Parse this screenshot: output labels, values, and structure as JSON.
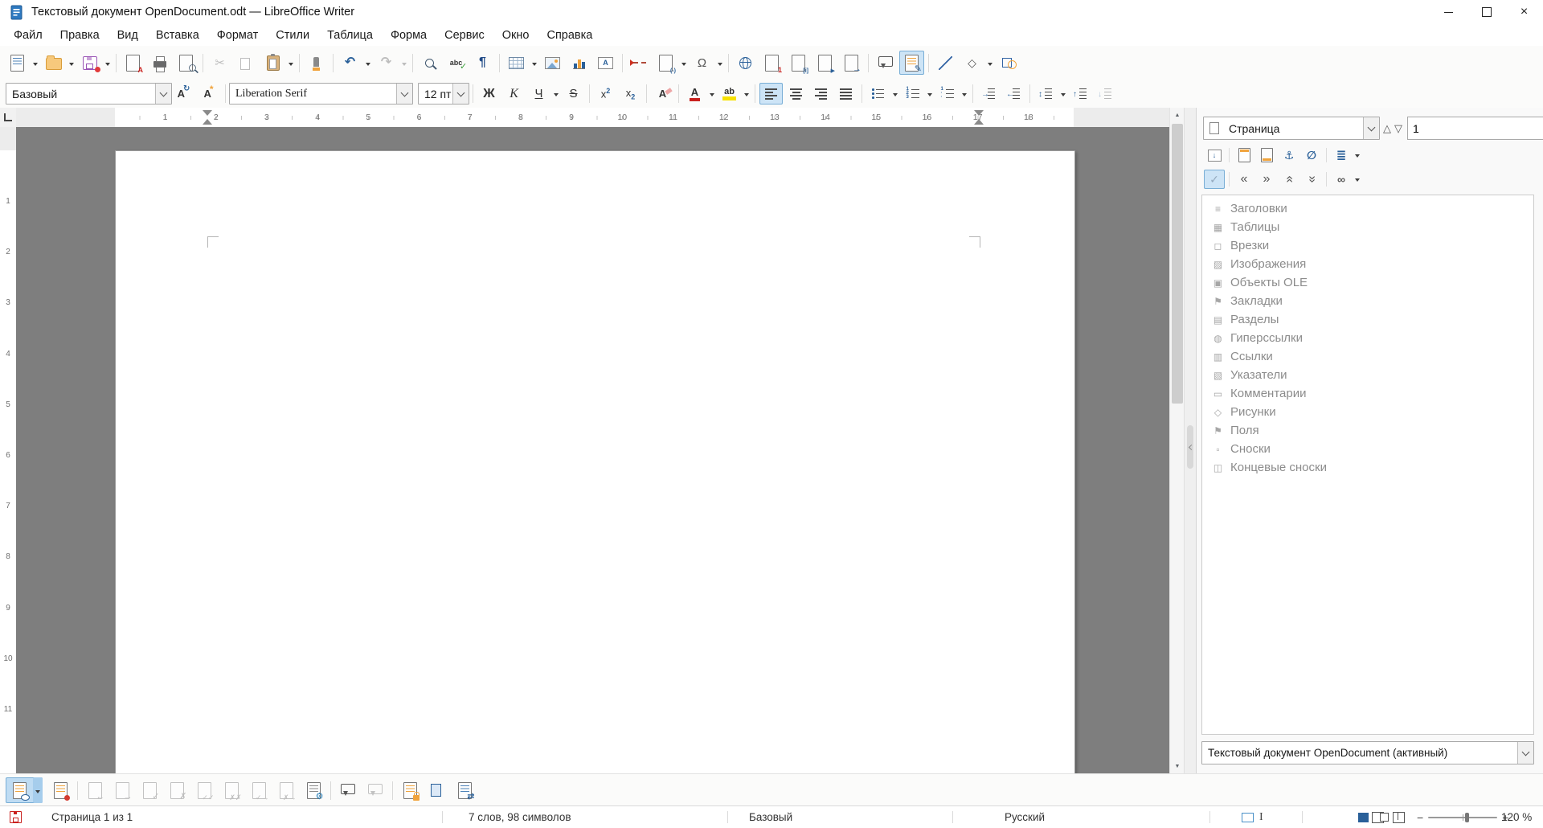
{
  "window": {
    "title": "Текстовый документ OpenDocument.odt — LibreOffice Writer"
  },
  "menubar": {
    "items": [
      {
        "label": "Файл"
      },
      {
        "label": "Правка"
      },
      {
        "label": "Вид"
      },
      {
        "label": "Вставка"
      },
      {
        "label": "Формат"
      },
      {
        "label": "Стили"
      },
      {
        "label": "Таблица"
      },
      {
        "label": "Форма"
      },
      {
        "label": "Сервис"
      },
      {
        "label": "Окно"
      },
      {
        "label": "Справка"
      }
    ]
  },
  "toolbar_standard": {
    "buttons": [
      "new-document",
      "open",
      "save",
      "export-pdf",
      "print",
      "print-preview",
      "cut",
      "copy",
      "paste",
      "clone-formatting",
      "undo",
      "redo",
      "find-replace",
      "spelling",
      "formatting-marks",
      "insert-table",
      "insert-image",
      "insert-chart",
      "insert-text-box",
      "insert-page-break",
      "insert-field",
      "insert-special-character",
      "insert-hyperlink",
      "insert-footnote",
      "insert-endnote",
      "insert-bookmark",
      "insert-cross-reference",
      "insert-comment",
      "track-changes",
      "insert-line",
      "basic-shapes",
      "show-draw-functions"
    ]
  },
  "toolbar_formatting": {
    "paragraph_style": "Базовый",
    "font_name": "Liberation Serif",
    "font_size": "12 пт"
  },
  "ruler": {
    "h_numbers": [
      "1",
      "2",
      "3",
      "4",
      "5",
      "6",
      "7",
      "8",
      "9",
      "10",
      "11",
      "12",
      "13",
      "14",
      "15",
      "16",
      "17",
      "18"
    ],
    "v_numbers": [
      "1",
      "2",
      "3",
      "4",
      "5",
      "6",
      "7",
      "8",
      "9",
      "10",
      "11"
    ]
  },
  "navigator": {
    "mode": "Страница",
    "page_number": "1",
    "toolbar": [
      "navigation-toggle",
      "header",
      "footer",
      "anchor-text-toggle",
      "set-reminder",
      "drag-mode",
      "content-navigation-view",
      "move-backward",
      "move-forward",
      "promote-level",
      "demote-level",
      "update-link"
    ],
    "items": [
      {
        "icon": "headings-icon",
        "glyph": "≡",
        "label": "Заголовки"
      },
      {
        "icon": "tables-icon",
        "glyph": "▦",
        "label": "Таблицы"
      },
      {
        "icon": "frames-icon",
        "glyph": "◻",
        "label": "Врезки"
      },
      {
        "icon": "images-icon",
        "glyph": "▨",
        "label": "Изображения"
      },
      {
        "icon": "ole-objects-icon",
        "glyph": "▣",
        "label": "Объекты OLE"
      },
      {
        "icon": "bookmarks-icon",
        "glyph": "⚑",
        "label": "Закладки"
      },
      {
        "icon": "sections-icon",
        "glyph": "▤",
        "label": "Разделы"
      },
      {
        "icon": "hyperlinks-icon",
        "glyph": "◍",
        "label": "Гиперссылки"
      },
      {
        "icon": "references-icon",
        "glyph": "▥",
        "label": "Ссылки"
      },
      {
        "icon": "indexes-icon",
        "glyph": "▧",
        "label": "Указатели"
      },
      {
        "icon": "comments-icon",
        "glyph": "▭",
        "label": "Комментарии"
      },
      {
        "icon": "drawings-icon",
        "glyph": "◇",
        "label": "Рисунки"
      },
      {
        "icon": "fields-icon",
        "glyph": "⚑",
        "label": "Поля"
      },
      {
        "icon": "footnotes-icon",
        "glyph": "▫",
        "label": "Сноски"
      },
      {
        "icon": "endnotes-icon",
        "glyph": "◫",
        "label": "Концевые сноски"
      }
    ],
    "document_select": "Текстовый документ OpenDocument (активный)"
  },
  "track_toolbar": {
    "buttons": [
      "show-changes",
      "record-changes",
      "previous-change",
      "next-change",
      "accept-change",
      "reject-change",
      "accept-all-changes",
      "reject-all-changes",
      "accept-and-next",
      "reject-and-next",
      "manage-changes",
      "insert-comment",
      "delete-comment",
      "protect-changes",
      "compare-documents",
      "merge-documents"
    ]
  },
  "statusbar": {
    "page": "Страница 1 из 1",
    "word_count": "7 слов, 98 символов",
    "style": "Базовый",
    "language": "Русский",
    "zoom_level": "120 %"
  },
  "glyphs": {
    "cut": "✂",
    "undo": "↶",
    "redo": "↷",
    "pilcrow": "¶",
    "spell_abc": "abc",
    "check": "✓",
    "omega": "Ω",
    "shapes_diamond": "◇",
    "letter_A": "A",
    "ab": "ab",
    "one": "1",
    "endnote_i": "[i]",
    "field": "(-)",
    "bookmark_arrow": "▶",
    "crossref_arrow": "→",
    "pencil": "✎",
    "pdf_a": "A",
    "sup_x": "x",
    "sup_2": "2",
    "numbered_list": "1\n2\n3",
    "outline_list": "1\n·\n·",
    "arrow_right": "→",
    "arrow_left": "←",
    "arrow_up": "↑",
    "arrow_down": "↓",
    "updown": "↕",
    "refresh": "↻",
    "star": "*",
    "nav_prev": "△",
    "nav_next": "▽",
    "spin_up": "▲",
    "spin_down": "▼",
    "backward": "«",
    "forward": "»",
    "link_chain": "∞",
    "anchor": "⚓",
    "reminder": "∅",
    "drag_lines": "≣",
    "reject": "✗",
    "accept_all": "✓✓",
    "reject_all": "✗✗",
    "accept_next": "✓→",
    "reject_next": "✗→",
    "gear": "⚙",
    "merge": "⇄",
    "sb_up": "▲",
    "sb_down": "▼",
    "minus": "−",
    "plus": "+",
    "ibeam": "I",
    "close": "×"
  },
  "colors": {
    "accent": "#2a6099",
    "active_bg": "#cde4f6",
    "active_border": "#79aed6",
    "canvas_gray": "#7e7e7e",
    "disabled_gray": "#bdbdbd",
    "tree_text": "#8c8c8c",
    "highlight_yellow": "#f7e100",
    "font_color_red": "#c9211e"
  }
}
